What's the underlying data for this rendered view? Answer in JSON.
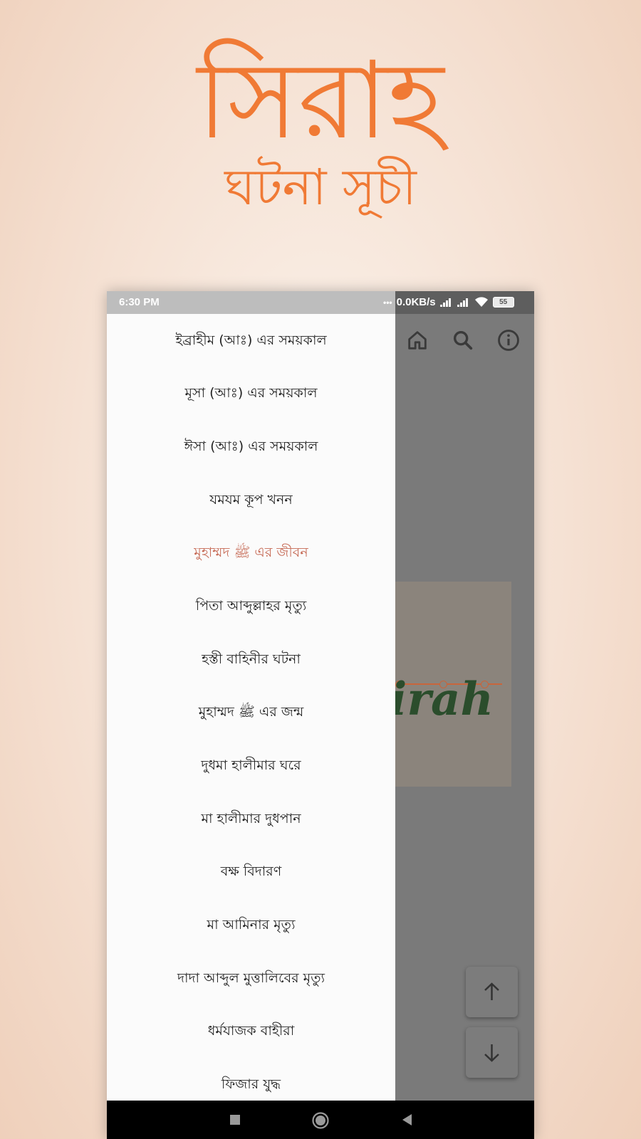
{
  "promo": {
    "title": "সিরাহ",
    "subtitle": "ঘটনা সূচী",
    "accent_color": "#f07a35"
  },
  "status_bar": {
    "time": "6:30 PM",
    "speed": "0.0KB/s",
    "battery": "55"
  },
  "app_bar": {
    "icons": [
      "home-icon",
      "search-icon",
      "info-icon"
    ]
  },
  "content": {
    "logo_text": "irah"
  },
  "drawer": {
    "items": [
      {
        "label": "ইব্রাহীম (আঃ) এর সময়কাল",
        "active": false
      },
      {
        "label": "মূসা (আঃ) এর সময়কাল",
        "active": false
      },
      {
        "label": "ঈসা (আঃ) এর সময়কাল",
        "active": false
      },
      {
        "label": "যমযম কূপ খনন",
        "active": false
      },
      {
        "label": "মুহাম্মদ ﷺ এর জীবন",
        "active": true
      },
      {
        "label": "পিতা আব্দুল্লাহর মৃত্যু",
        "active": false
      },
      {
        "label": "হস্তী বাহিনীর ঘটনা",
        "active": false
      },
      {
        "label": "মুহাম্মদ ﷺ এর জন্ম",
        "active": false
      },
      {
        "label": "দুধমা হালীমার ঘরে",
        "active": false
      },
      {
        "label": "মা হালীমার দুধপান",
        "active": false
      },
      {
        "label": "বক্ষ বিদারণ",
        "active": false
      },
      {
        "label": "মা আমিনার মৃত্যু",
        "active": false
      },
      {
        "label": "দাদা আব্দুল মুত্তালিবের মৃত্যু",
        "active": false
      },
      {
        "label": "ধর্মযাজক বাহীরা",
        "active": false
      },
      {
        "label": "ফিজার যুদ্ধ",
        "active": false
      }
    ]
  },
  "fabs": {
    "icons": [
      "arrow-up-icon",
      "arrow-down-icon"
    ]
  },
  "nav_bar": {
    "icons": [
      "recents-icon",
      "home-circle-icon",
      "back-icon"
    ]
  }
}
